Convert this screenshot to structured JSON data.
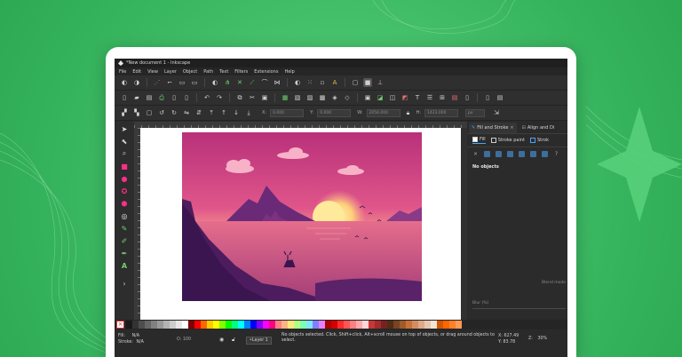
{
  "window": {
    "title": "*New document 1 - Inkscape"
  },
  "menu": [
    "File",
    "Edit",
    "View",
    "Layer",
    "Object",
    "Path",
    "Text",
    "Filters",
    "Extensions",
    "Help"
  ],
  "coords_toolbar": {
    "x_label": "X:",
    "x_value": "0.000",
    "y_label": "Y:",
    "y_value": "0.000",
    "w_label": "W:",
    "w_value": "2056.000",
    "h_label": "H:",
    "h_value": "1423.000",
    "unit": "px"
  },
  "dock": {
    "tabs": [
      {
        "label": "Fill and Stroke",
        "close": "×"
      },
      {
        "label": "Align and Di"
      }
    ],
    "fill_tabs": [
      "Fill",
      "Stroke paint",
      "Strok"
    ],
    "no_objects": "No objects",
    "blend_label": "Blend mode",
    "blur_label": "Blur (%)"
  },
  "palette": {
    "none_symbol": "×",
    "colors": [
      "#1a1a1a",
      "#333333",
      "#4d4d4d",
      "#666666",
      "#808080",
      "#999999",
      "#b3b3b3",
      "#cccccc",
      "#e6e6e6",
      "#ffffff",
      "#800000",
      "#ff0000",
      "#ff6600",
      "#ffcc00",
      "#ffff00",
      "#80ff00",
      "#00ff00",
      "#00ff80",
      "#00ffff",
      "#0080ff",
      "#0000ff",
      "#8000ff",
      "#ff00ff",
      "#ff0080",
      "#ff8080",
      "#ffb380",
      "#ffe680",
      "#b3ff80",
      "#80ffb3",
      "#80e5ff",
      "#8080ff",
      "#e680ff",
      "#aa0000",
      "#d40000",
      "#ff2a2a",
      "#ff5555",
      "#ff8080",
      "#ffaaaa",
      "#ffd5d5",
      "#c83737",
      "#a02c2c",
      "#782121",
      "#502d16",
      "#784421",
      "#a05a2c",
      "#c87137",
      "#d38d5f",
      "#deaa87",
      "#e9c6af",
      "#f4e3d7",
      "#d45500",
      "#ff6600",
      "#ff7f2a",
      "#ff9955"
    ]
  },
  "status": {
    "fill_label": "Fill:",
    "fill_value": "N/A",
    "stroke_label": "Stroke:",
    "stroke_value": "N/A",
    "opacity_label": "O:",
    "opacity_value": "100",
    "layer": "•Layer 1",
    "message": "No objects selected. Click, Shift+click, Alt+scroll mouse on top of objects, or drag around objects to select.",
    "x_label": "X:",
    "x_value": "627.49",
    "y_label": "Y:",
    "y_value": "83.78",
    "z_label": "Z:",
    "zoom_value": "30%"
  },
  "colors": {
    "accent": "#4aa3ff",
    "background_green": "#46c16c",
    "ui_dark": "#2b2b2b"
  }
}
